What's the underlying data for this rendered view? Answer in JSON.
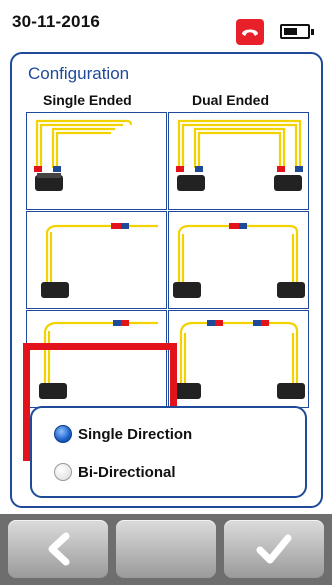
{
  "status": {
    "date": "30-11-2016",
    "phone_icon": "phone-hangup-icon",
    "battery_icon": "battery-icon"
  },
  "config": {
    "title": "Configuration",
    "col_single": "Single Ended",
    "col_dual": "Dual Ended"
  },
  "direction": {
    "selected": "Single Direction",
    "options": [
      {
        "label": "Single Direction",
        "selected": true
      },
      {
        "label": "Bi-Directional",
        "selected": false
      }
    ]
  },
  "nav": {
    "back_icon": "chevron-left-icon",
    "middle_icon": "blank",
    "ok_icon": "checkmark-icon"
  },
  "colors": {
    "accent": "#1f4a9a",
    "highlight": "#e3131c",
    "fiber": "#f2d300"
  }
}
